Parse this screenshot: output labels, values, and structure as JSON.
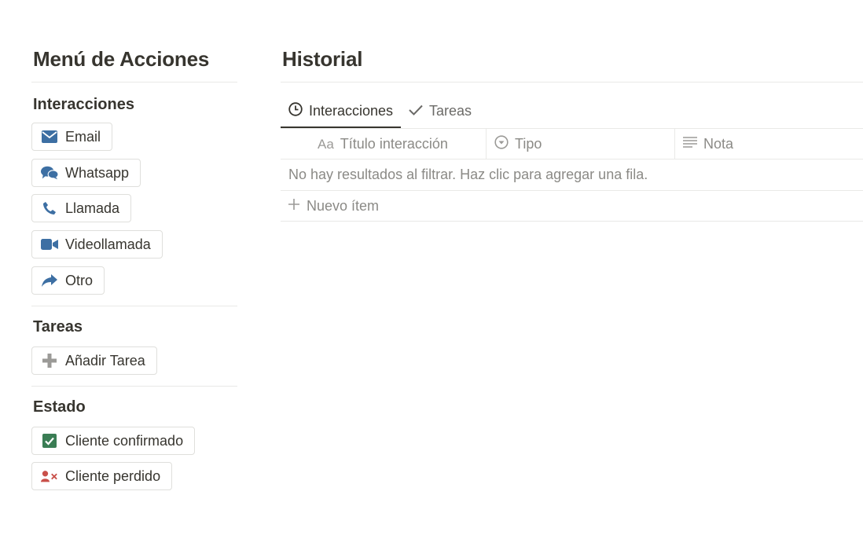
{
  "left": {
    "title": "Menú de Acciones",
    "sections": [
      {
        "title": "Interacciones",
        "buttons": [
          {
            "label": "Email",
            "icon": "mail-icon"
          },
          {
            "label": "Whatsapp",
            "icon": "chat-bubbles-icon"
          },
          {
            "label": "Llamada",
            "icon": "phone-icon"
          },
          {
            "label": "Videollamada",
            "icon": "video-camera-icon"
          },
          {
            "label": "Otro",
            "icon": "share-arrow-icon"
          }
        ]
      },
      {
        "title": "Tareas",
        "buttons": [
          {
            "label": "Añadir Tarea",
            "icon": "plus-icon"
          }
        ]
      },
      {
        "title": "Estado",
        "buttons": [
          {
            "label": "Cliente confirmado",
            "icon": "checkbox-icon"
          },
          {
            "label": "Cliente perdido",
            "icon": "user-remove-icon"
          }
        ]
      }
    ]
  },
  "right": {
    "title": "Historial",
    "tabs": [
      {
        "label": "Interacciones",
        "icon": "clock-icon",
        "active": true
      },
      {
        "label": "Tareas",
        "icon": "checkmark-icon",
        "active": false
      }
    ],
    "columns": [
      {
        "label": "Título interacción",
        "icon_text": "Aa"
      },
      {
        "label": "Tipo",
        "icon": "select-icon"
      },
      {
        "label": "Nota",
        "icon": "text-lines-icon"
      }
    ],
    "empty_message": "No hay resultados al filtrar. Haz clic para agregar una fila.",
    "new_item": "Nuevo ítem"
  },
  "colors": {
    "accent_blue": "#3d6fa3",
    "check_green": "#3a7d54",
    "danger_red": "#c9504a",
    "plus_gray": "#9b9a97"
  }
}
